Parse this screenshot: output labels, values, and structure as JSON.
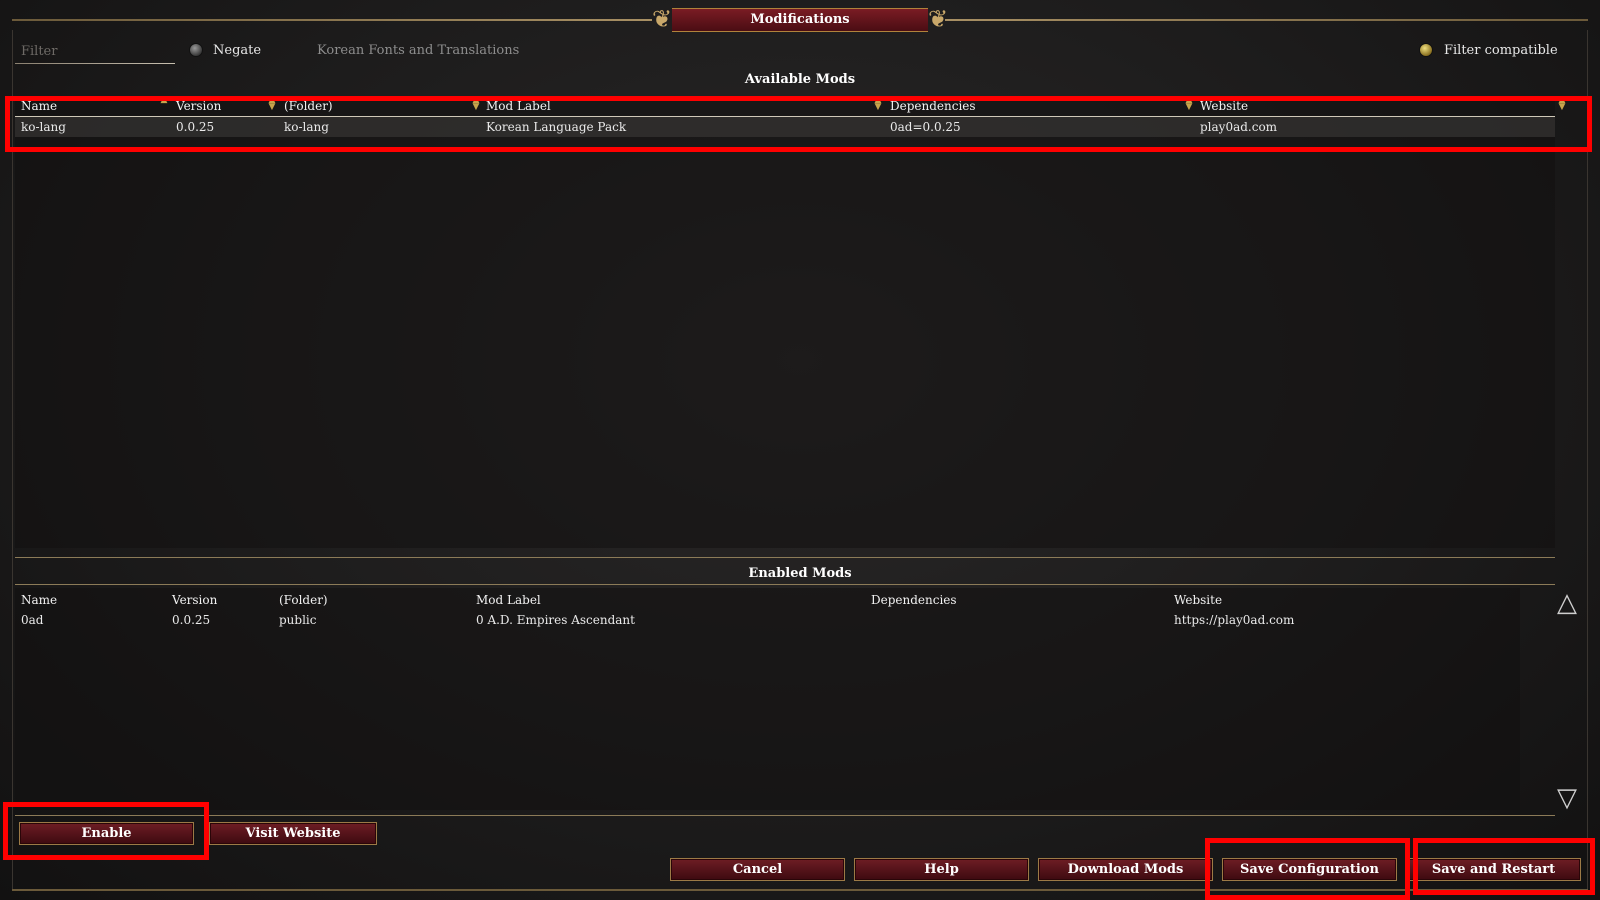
{
  "window": {
    "title": "Modifications"
  },
  "filter": {
    "placeholder": "Filter",
    "value": ""
  },
  "options": {
    "negate_label": "Negate",
    "selected_description": "Korean Fonts and Translations",
    "filter_compatible_label": "Filter compatible"
  },
  "available": {
    "title": "Available Mods",
    "columns": [
      "Name",
      "Version",
      "(Folder)",
      "Mod Label",
      "Dependencies",
      "Website"
    ],
    "rows": [
      [
        "ko-lang",
        "0.0.25",
        "ko-lang",
        "Korean Language Pack",
        "0ad=0.0.25",
        "play0ad.com"
      ]
    ]
  },
  "enabled": {
    "title": "Enabled Mods",
    "columns": [
      "Name",
      "Version",
      "(Folder)",
      "Mod Label",
      "Dependencies",
      "Website"
    ],
    "rows": [
      [
        "0ad",
        "0.0.25",
        "public",
        "0 A.D. Empires Ascendant",
        "",
        "https://play0ad.com"
      ]
    ]
  },
  "buttons": {
    "enable": "Enable",
    "visit_website": "Visit Website",
    "cancel": "Cancel",
    "help": "Help",
    "download_mods": "Download Mods",
    "save_configuration": "Save Configuration",
    "save_and_restart": "Save and Restart"
  },
  "icons": {
    "scroll_up": "up-triangle-icon",
    "scroll_down": "down-triangle-icon",
    "sort": "sort-arrows-icon"
  },
  "colors": {
    "highlight": "#ff0000",
    "button_fill": "#6e1d24",
    "gold_accent": "#c9a86a"
  }
}
